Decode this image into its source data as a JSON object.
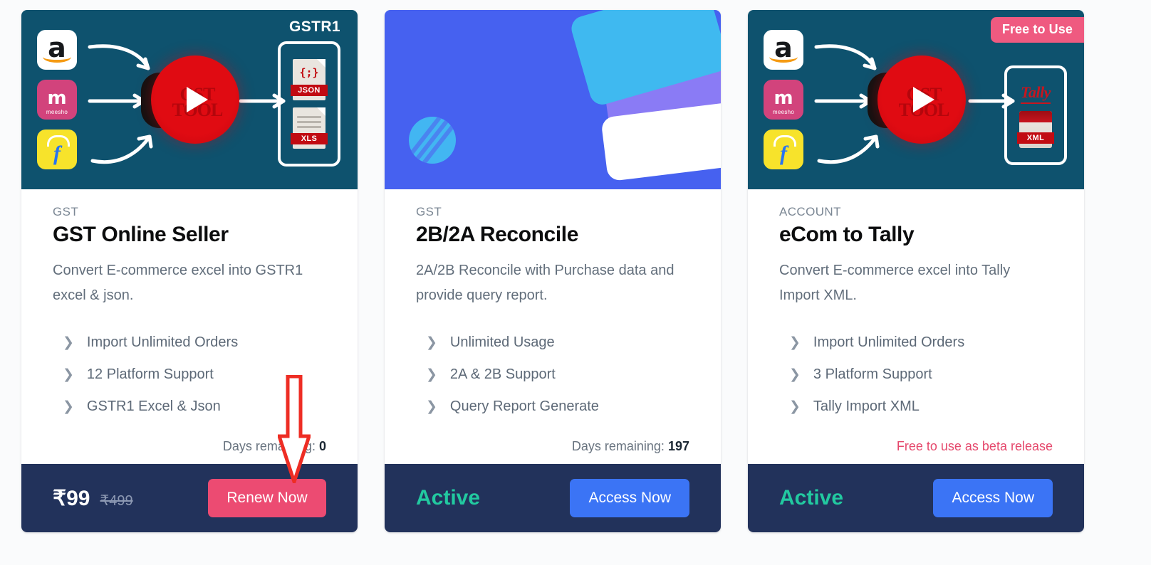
{
  "page": {
    "background_color": "#fafbfc",
    "card_background": "#ffffff",
    "footer_color": "#22325b",
    "accent_pink": "#ec4b72",
    "accent_blue": "#3b74f5",
    "accent_green": "#22c9a0",
    "annotation_color": "#ee2d24"
  },
  "cards": [
    {
      "hero": {
        "style": "navy",
        "background_color": "#0e526e",
        "output_label": "GSTR1",
        "output_files": [
          "JSON",
          "XLS"
        ],
        "center_logo_text": "GST TOOL",
        "platform_logos": [
          "amazon-icon",
          "meesho-icon",
          "flipkart-icon"
        ],
        "play_icon": "play-icon",
        "badge": null
      },
      "eyebrow": "GST",
      "title": "GST Online Seller",
      "description": "Convert E-commerce excel into GSTR1 excel & json.",
      "features": [
        "Import Unlimited Orders",
        "12 Platform Support",
        "GSTR1 Excel & Json"
      ],
      "meta_label": "Days remaining:",
      "meta_value": "0",
      "meta_style": "days",
      "footer": {
        "type": "price",
        "price_now": "₹99",
        "price_was": "₹499",
        "button_label": "Renew Now",
        "button_style": "renew"
      }
    },
    {
      "hero": {
        "style": "blue",
        "background_color": "#4661f0",
        "output_label": null,
        "output_files": [],
        "center_logo_text": null,
        "platform_logos": [],
        "play_icon": null,
        "badge": null
      },
      "eyebrow": "GST",
      "title": "2B/2A Reconcile",
      "description": "2A/2B Reconcile with Purchase data and provide query report.",
      "features": [
        "Unlimited Usage",
        "2A & 2B Support",
        "Query Report Generate"
      ],
      "meta_label": "Days remaining:",
      "meta_value": "197",
      "meta_style": "days",
      "footer": {
        "type": "status",
        "status_label": "Active",
        "button_label": "Access Now",
        "button_style": "access"
      }
    },
    {
      "hero": {
        "style": "navy",
        "background_color": "#0e526e",
        "output_label": null,
        "output_files": [
          "XML"
        ],
        "output_brand": "Tally",
        "center_logo_text": "GST TOOL",
        "platform_logos": [
          "amazon-icon",
          "meesho-icon",
          "flipkart-icon"
        ],
        "play_icon": "play-icon",
        "badge": "Free to Use"
      },
      "eyebrow": "ACCOUNT",
      "title": "eCom to Tally",
      "description": "Convert E-commerce excel into Tally Import XML.",
      "features": [
        "Import Unlimited Orders",
        "3 Platform Support",
        "Tally Import XML"
      ],
      "meta_label": "Free to use as beta release",
      "meta_value": "",
      "meta_style": "beta",
      "footer": {
        "type": "status",
        "status_label": "Active",
        "button_label": "Access Now",
        "button_style": "access"
      }
    }
  ],
  "annotation": {
    "type": "down-arrow",
    "points_to": "Renew Now"
  }
}
